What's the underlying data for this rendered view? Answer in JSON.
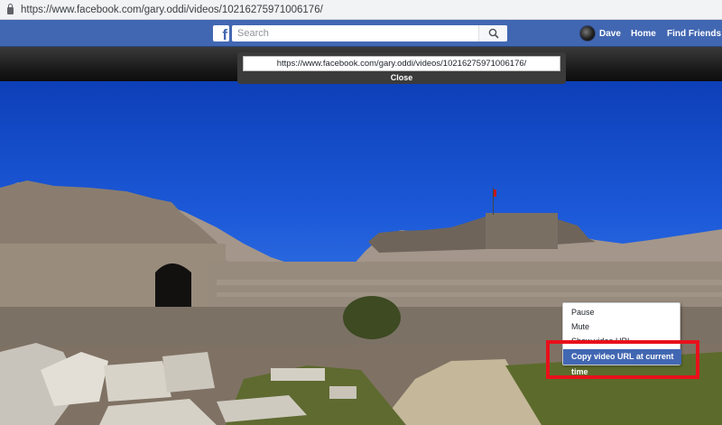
{
  "browser": {
    "url": "https://www.facebook.com/gary.oddi/videos/10216275971006176/",
    "lock_icon": "lock-icon"
  },
  "facebook_bar": {
    "logo": "f",
    "search_placeholder": "Search",
    "search_icon": "search-icon",
    "user_name": "Dave",
    "home_label": "Home",
    "find_friends_label": "Find Friends"
  },
  "url_popup": {
    "video_url": "https://www.facebook.com/gary.oddi/videos/10216275971006176/",
    "close_label": "Close"
  },
  "context_menu": {
    "items": [
      {
        "label": "Pause"
      },
      {
        "label": "Mute"
      },
      {
        "label": "Show video URL"
      },
      {
        "label": "Copy video URL at current time"
      }
    ]
  },
  "colors": {
    "facebook_blue": "#4267b2",
    "highlight_red": "#e8101a",
    "menu_selected": "#4267b2"
  }
}
